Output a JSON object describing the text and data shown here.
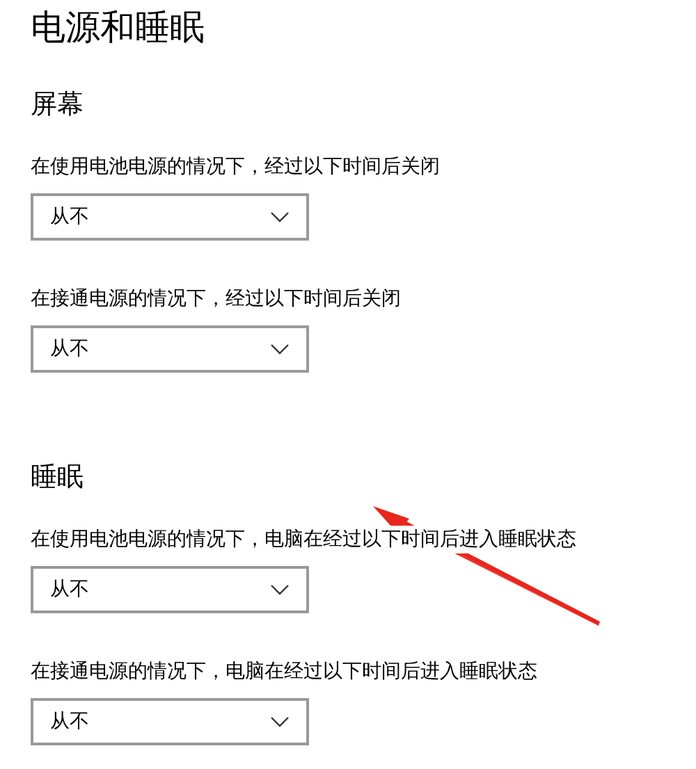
{
  "title": "电源和睡眠",
  "sections": [
    {
      "heading": "屏幕",
      "settings": [
        {
          "label": "在使用电池电源的情况下，经过以下时间后关闭",
          "value": "从不"
        },
        {
          "label": "在接通电源的情况下，经过以下时间后关闭",
          "value": "从不"
        }
      ]
    },
    {
      "heading": "睡眠",
      "settings": [
        {
          "label": "在使用电池电源的情况下，电脑在经过以下时间后进入睡眠状态",
          "value": "从不"
        },
        {
          "label": "在接通电源的情况下，电脑在经过以下时间后进入睡眠状态",
          "value": "从不"
        }
      ]
    }
  ]
}
